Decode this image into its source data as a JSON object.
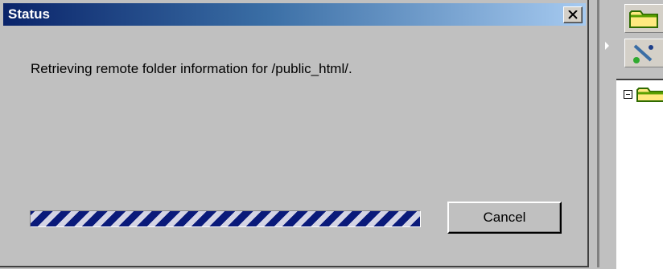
{
  "dialog": {
    "title": "Status",
    "message": "Retrieving remote folder information for /public_html/.",
    "progress_fraction": 1.0,
    "cancel_label": "Cancel",
    "close_symbol": "×"
  },
  "side_panel": {
    "icons": [
      "folder-icon",
      "connect-icon",
      "folder-icon"
    ],
    "tree_toggle": "collapse"
  },
  "colors": {
    "title_bar_start": "#0a246a",
    "title_bar_end": "#a6caf0",
    "progress_stripe": "#0a1a7a",
    "dialog_face": "#c0c0c0"
  }
}
